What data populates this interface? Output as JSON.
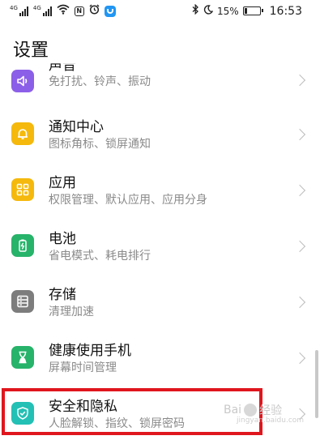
{
  "status_bar": {
    "signal1_label": "4G",
    "signal2_label": "4G",
    "battery_percent": "15%",
    "battery_level": 0.15,
    "time": "16:53",
    "icons": [
      "signal-icon",
      "signal-icon",
      "wifi-icon",
      "nfc-icon",
      "alarm-icon",
      "app-notification-icon",
      "bluetooth-icon",
      "do-not-disturb-icon",
      "battery-icon"
    ]
  },
  "header": {
    "title": "设置"
  },
  "settings": {
    "items": [
      {
        "title": "声音",
        "subtitle": "免打扰、铃声、振动",
        "icon": "speaker-icon",
        "color": "#8c5fe8"
      },
      {
        "title": "通知中心",
        "subtitle": "图标角标、锁屏通知",
        "icon": "bell-icon",
        "color": "#f5b90d"
      },
      {
        "title": "应用",
        "subtitle": "权限管理、默认应用、应用分身",
        "icon": "apps-grid-icon",
        "color": "#f5b90d"
      },
      {
        "title": "电池",
        "subtitle": "省电模式、耗电排行",
        "icon": "battery-charge-icon",
        "color": "#27b36a"
      },
      {
        "title": "存储",
        "subtitle": "清理加速",
        "icon": "storage-icon",
        "color": "#7d7d7d"
      },
      {
        "title": "健康使用手机",
        "subtitle": "屏幕时间管理",
        "icon": "hourglass-icon",
        "color": "#27b36a"
      },
      {
        "title": "安全和隐私",
        "subtitle": "人脸解锁、指纹、锁屏密码",
        "icon": "shield-check-icon",
        "color": "#23c0b5"
      }
    ]
  },
  "watermark": {
    "text": "Bai",
    "text2": "经验",
    "site": "jingyan.baidu.com"
  },
  "highlight_color": "#e0161e"
}
